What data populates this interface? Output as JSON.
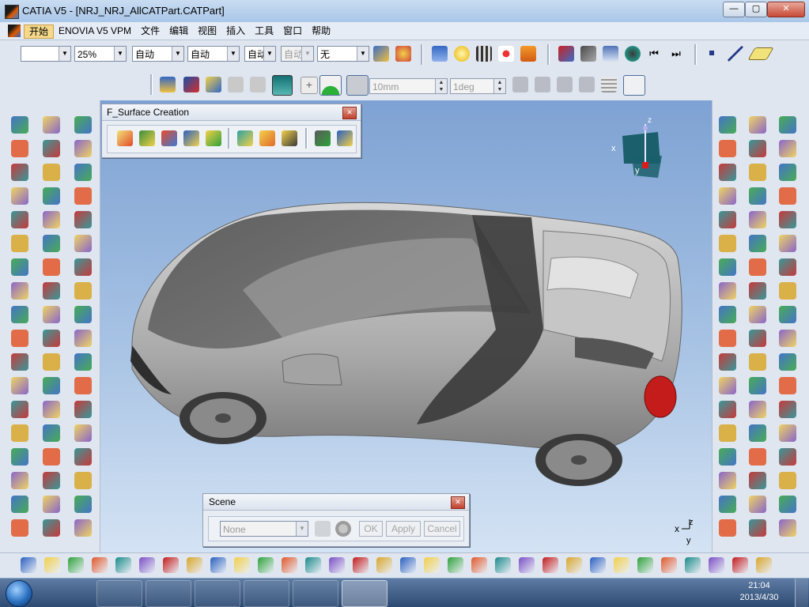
{
  "window": {
    "title": "CATIA V5 - [NRJ_NRJ_AllCATPart.CATPart]",
    "minimize_label": "—",
    "maximize_label": "▢",
    "close_label": "✕"
  },
  "menu": {
    "items": [
      "开始",
      "ENOVIA V5 VPM",
      "文件",
      "编辑",
      "视图",
      "插入",
      "工具",
      "窗口",
      "帮助"
    ],
    "mdi_min": "–",
    "mdi_restore": "❐",
    "mdi_close": "✕"
  },
  "toolbar1": {
    "color_combo": "",
    "transparency_combo": "25%",
    "line_thickness_combo": "自动",
    "line_type_combo": "自动",
    "point_combo": "自动",
    "layer_combo": "自动",
    "render_combo": "无"
  },
  "toolbar2": {
    "step_value": "10mm",
    "angle_value": "1deg"
  },
  "surface_toolbar": {
    "title": "F_Surface Creation",
    "close_label": "✕"
  },
  "scene_toolbar": {
    "title": "Scene",
    "close_label": "✕",
    "scene_combo": "None",
    "ok_label": "OK",
    "apply_label": "Apply",
    "cancel_label": "Cancel"
  },
  "compass": {
    "x_label": "x",
    "y_label": "y",
    "z_label": "z"
  },
  "axis_triad": {
    "x_label": "x",
    "y_label": "y",
    "z_label": "z"
  },
  "taskbar": {
    "time": "21:04",
    "date": "2013/4/30"
  },
  "colors": {
    "viewport_top": "#7ea2d3",
    "viewport_bottom": "#d4e3f4",
    "accent": "#f5d88a",
    "car_body": "#b9b9b9"
  }
}
